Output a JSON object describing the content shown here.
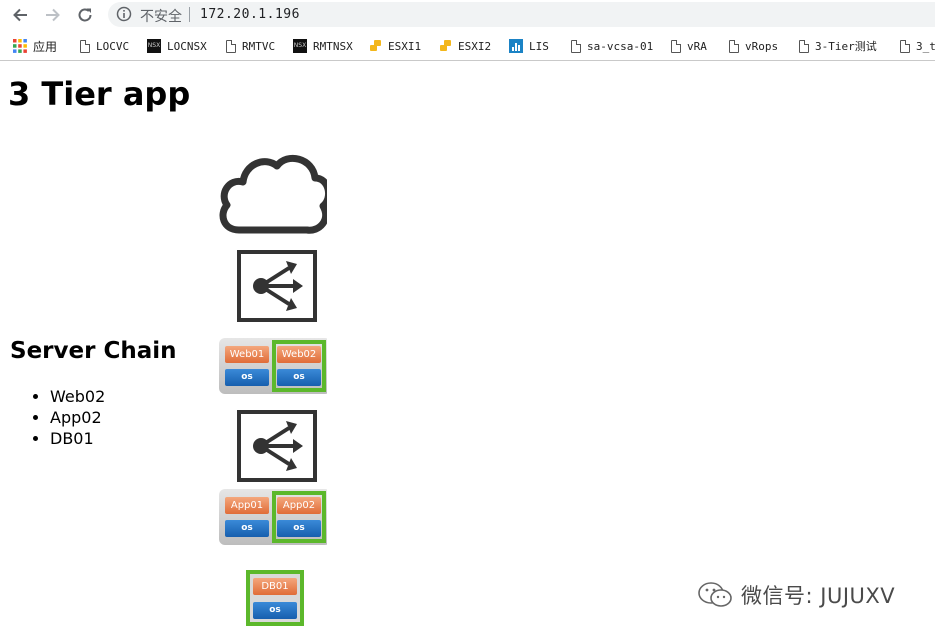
{
  "browser": {
    "security_label": "不安全",
    "url": "172.20.1.196",
    "bookmarks": [
      {
        "label": "应用",
        "icon": "apps-grid-icon"
      },
      {
        "label": "LOCVC",
        "icon": "page-icon"
      },
      {
        "label": "LOCNSX",
        "icon": "nsx-icon"
      },
      {
        "label": "RMTVC",
        "icon": "page-icon"
      },
      {
        "label": "RMTNSX",
        "icon": "nsx-icon"
      },
      {
        "label": "ESXI1",
        "icon": "vmware-icon"
      },
      {
        "label": "ESXI2",
        "icon": "vmware-icon"
      },
      {
        "label": "LIS",
        "icon": "lis-icon"
      },
      {
        "label": "sa-vcsa-01",
        "icon": "page-icon"
      },
      {
        "label": "vRA",
        "icon": "page-icon"
      },
      {
        "label": "vRops",
        "icon": "page-icon"
      },
      {
        "label": "3-Tier测试",
        "icon": "page-icon"
      },
      {
        "label": "3_t",
        "icon": "page-icon"
      }
    ]
  },
  "page": {
    "title": "3 Tier app",
    "chain_heading": "Server Chain",
    "chain_items": [
      "Web02",
      "App02",
      "DB01"
    ]
  },
  "diagram": {
    "web_group": [
      {
        "name": "Web01",
        "os": "os",
        "selected": false
      },
      {
        "name": "Web02",
        "os": "os",
        "selected": true
      }
    ],
    "app_group": [
      {
        "name": "App01",
        "os": "os",
        "selected": false
      },
      {
        "name": "App02",
        "os": "os",
        "selected": true
      }
    ],
    "db_group": [
      {
        "name": "DB01",
        "os": "os",
        "selected": true
      }
    ]
  },
  "watermark": {
    "text": "微信号: JUJUXV"
  },
  "colors": {
    "selected_border": "#5cb82b",
    "app_tile": "#e88550",
    "os_tile": "#2a74c5"
  }
}
